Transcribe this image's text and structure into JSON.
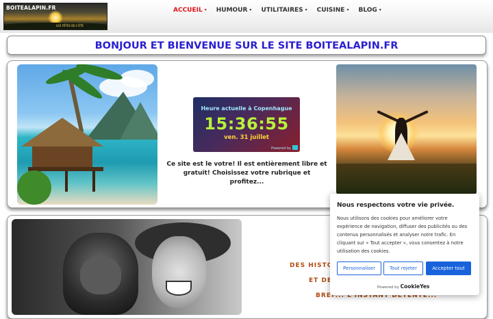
{
  "header": {
    "logo_text": "BOITEALAPIN.FR",
    "logo_tagline": "LES FÊTES DE L'ÉTÉ",
    "nav": [
      {
        "label": "ACCUEIL",
        "active": true
      },
      {
        "label": "HUMOUR",
        "active": false
      },
      {
        "label": "UTILITAIRES",
        "active": false
      },
      {
        "label": "CUISINE",
        "active": false
      },
      {
        "label": "BLOG",
        "active": false
      }
    ],
    "caret": "▾"
  },
  "banner": {
    "title": "BONJOUR ET BIENVENUE SUR LE SITE BOITEALAPIN.FR"
  },
  "clock": {
    "city": "Heure actuelle à Copenhague",
    "time": "15:36:55",
    "date": "ven. 31 juillet",
    "powered": "Powered by"
  },
  "welcome_text": "Ce site est le votre! Il est entièrement libre et gratuit! Choisissez votre rubrique et profitez...",
  "story": {
    "lines": [
      "DES HISTOI",
      "ET DE",
      "BREF... L'INSTANT DÉTENTE..."
    ]
  },
  "cookie": {
    "title": "Nous respectons votre vie privée.",
    "text": "Nous utilisons des cookies pour améliorer votre expérience de navigation, diffuser des publicités ou des contenus personnalisés et analyser notre trafic. En cliquant sur « Tout accepter », vous consentez à notre utilisation des cookies.",
    "buttons": {
      "customize": "Personnaliser",
      "reject": "Tout rejeter",
      "accept": "Accepter tout"
    },
    "powered_by": "Powered by",
    "brand": "CookieYes"
  },
  "colors": {
    "nav_active": "#e0121a",
    "banner_title": "#2a1fd0",
    "accent_button": "#1863dc",
    "story_text": "#b24a12"
  }
}
